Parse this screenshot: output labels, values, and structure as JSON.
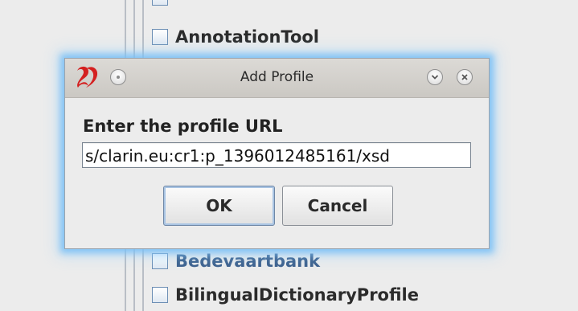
{
  "background": {
    "items": [
      {
        "label": "AnnotationTool",
        "checked": false
      },
      {
        "label": "Bedevaartbank",
        "checked": false
      },
      {
        "label": "BilingualDictionaryProfile",
        "checked": false
      }
    ]
  },
  "dialog": {
    "title": "Add Profile",
    "prompt": "Enter the profile URL",
    "url_value": "s/clarin.eu:cr1:p_1396012485161/xsd",
    "ok_label": "OK",
    "cancel_label": "Cancel",
    "icons": {
      "app": "app-logo-icon",
      "menu": "window-menu-icon",
      "minimize": "chevron-down-icon",
      "close": "close-icon"
    }
  },
  "colors": {
    "focus_glow": "#78bef5",
    "link_text": "#3b5f8c",
    "app_icon": "#d42020"
  }
}
